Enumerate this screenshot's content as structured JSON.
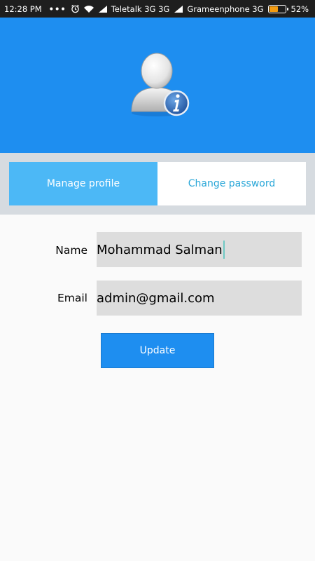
{
  "status_bar": {
    "time": "12:28 PM",
    "dots": "•••",
    "carrier1": "Teletalk 3G 3G",
    "carrier2": "Grameenphone 3G",
    "battery": "52%",
    "battery_level": 0.52,
    "icons": [
      "alarm-icon",
      "wifi-icon",
      "signal-icon",
      "signal-icon",
      "battery-icon"
    ]
  },
  "header": {
    "avatar_icon": "user-info-icon",
    "background": "#1e8ef0"
  },
  "tabs": [
    {
      "label": "Manage profile",
      "active": true
    },
    {
      "label": "Change password",
      "active": false
    }
  ],
  "form": {
    "name_label": "Name",
    "name_value": "Mohammad Salman",
    "email_label": "Email",
    "email_value": "admin@gmail.com"
  },
  "actions": {
    "update_label": "Update"
  },
  "colors": {
    "accent": "#1e8ef0",
    "tab_active": "#4cb8f6",
    "tab_inactive_text": "#2aa7d8"
  }
}
